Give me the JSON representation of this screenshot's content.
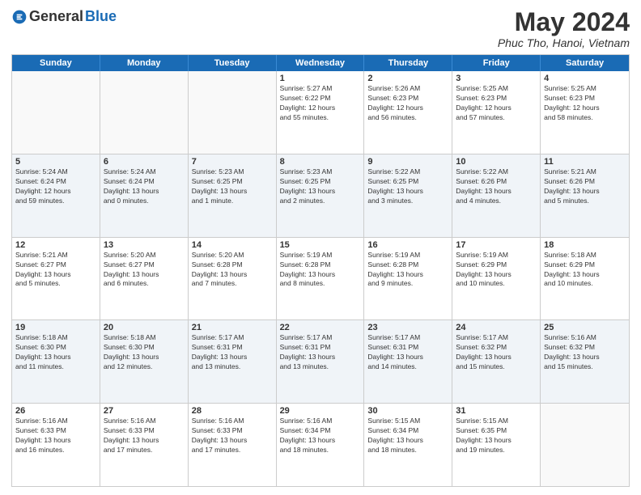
{
  "header": {
    "logo_general": "General",
    "logo_blue": "Blue",
    "title": "May 2024",
    "location": "Phuc Tho, Hanoi, Vietnam"
  },
  "days_of_week": [
    "Sunday",
    "Monday",
    "Tuesday",
    "Wednesday",
    "Thursday",
    "Friday",
    "Saturday"
  ],
  "weeks": [
    [
      {
        "day": "",
        "info": ""
      },
      {
        "day": "",
        "info": ""
      },
      {
        "day": "",
        "info": ""
      },
      {
        "day": "1",
        "info": "Sunrise: 5:27 AM\nSunset: 6:22 PM\nDaylight: 12 hours\nand 55 minutes."
      },
      {
        "day": "2",
        "info": "Sunrise: 5:26 AM\nSunset: 6:23 PM\nDaylight: 12 hours\nand 56 minutes."
      },
      {
        "day": "3",
        "info": "Sunrise: 5:25 AM\nSunset: 6:23 PM\nDaylight: 12 hours\nand 57 minutes."
      },
      {
        "day": "4",
        "info": "Sunrise: 5:25 AM\nSunset: 6:23 PM\nDaylight: 12 hours\nand 58 minutes."
      }
    ],
    [
      {
        "day": "5",
        "info": "Sunrise: 5:24 AM\nSunset: 6:24 PM\nDaylight: 12 hours\nand 59 minutes."
      },
      {
        "day": "6",
        "info": "Sunrise: 5:24 AM\nSunset: 6:24 PM\nDaylight: 13 hours\nand 0 minutes."
      },
      {
        "day": "7",
        "info": "Sunrise: 5:23 AM\nSunset: 6:25 PM\nDaylight: 13 hours\nand 1 minute."
      },
      {
        "day": "8",
        "info": "Sunrise: 5:23 AM\nSunset: 6:25 PM\nDaylight: 13 hours\nand 2 minutes."
      },
      {
        "day": "9",
        "info": "Sunrise: 5:22 AM\nSunset: 6:25 PM\nDaylight: 13 hours\nand 3 minutes."
      },
      {
        "day": "10",
        "info": "Sunrise: 5:22 AM\nSunset: 6:26 PM\nDaylight: 13 hours\nand 4 minutes."
      },
      {
        "day": "11",
        "info": "Sunrise: 5:21 AM\nSunset: 6:26 PM\nDaylight: 13 hours\nand 5 minutes."
      }
    ],
    [
      {
        "day": "12",
        "info": "Sunrise: 5:21 AM\nSunset: 6:27 PM\nDaylight: 13 hours\nand 5 minutes."
      },
      {
        "day": "13",
        "info": "Sunrise: 5:20 AM\nSunset: 6:27 PM\nDaylight: 13 hours\nand 6 minutes."
      },
      {
        "day": "14",
        "info": "Sunrise: 5:20 AM\nSunset: 6:28 PM\nDaylight: 13 hours\nand 7 minutes."
      },
      {
        "day": "15",
        "info": "Sunrise: 5:19 AM\nSunset: 6:28 PM\nDaylight: 13 hours\nand 8 minutes."
      },
      {
        "day": "16",
        "info": "Sunrise: 5:19 AM\nSunset: 6:28 PM\nDaylight: 13 hours\nand 9 minutes."
      },
      {
        "day": "17",
        "info": "Sunrise: 5:19 AM\nSunset: 6:29 PM\nDaylight: 13 hours\nand 10 minutes."
      },
      {
        "day": "18",
        "info": "Sunrise: 5:18 AM\nSunset: 6:29 PM\nDaylight: 13 hours\nand 10 minutes."
      }
    ],
    [
      {
        "day": "19",
        "info": "Sunrise: 5:18 AM\nSunset: 6:30 PM\nDaylight: 13 hours\nand 11 minutes."
      },
      {
        "day": "20",
        "info": "Sunrise: 5:18 AM\nSunset: 6:30 PM\nDaylight: 13 hours\nand 12 minutes."
      },
      {
        "day": "21",
        "info": "Sunrise: 5:17 AM\nSunset: 6:31 PM\nDaylight: 13 hours\nand 13 minutes."
      },
      {
        "day": "22",
        "info": "Sunrise: 5:17 AM\nSunset: 6:31 PM\nDaylight: 13 hours\nand 13 minutes."
      },
      {
        "day": "23",
        "info": "Sunrise: 5:17 AM\nSunset: 6:31 PM\nDaylight: 13 hours\nand 14 minutes."
      },
      {
        "day": "24",
        "info": "Sunrise: 5:17 AM\nSunset: 6:32 PM\nDaylight: 13 hours\nand 15 minutes."
      },
      {
        "day": "25",
        "info": "Sunrise: 5:16 AM\nSunset: 6:32 PM\nDaylight: 13 hours\nand 15 minutes."
      }
    ],
    [
      {
        "day": "26",
        "info": "Sunrise: 5:16 AM\nSunset: 6:33 PM\nDaylight: 13 hours\nand 16 minutes."
      },
      {
        "day": "27",
        "info": "Sunrise: 5:16 AM\nSunset: 6:33 PM\nDaylight: 13 hours\nand 17 minutes."
      },
      {
        "day": "28",
        "info": "Sunrise: 5:16 AM\nSunset: 6:33 PM\nDaylight: 13 hours\nand 17 minutes."
      },
      {
        "day": "29",
        "info": "Sunrise: 5:16 AM\nSunset: 6:34 PM\nDaylight: 13 hours\nand 18 minutes."
      },
      {
        "day": "30",
        "info": "Sunrise: 5:15 AM\nSunset: 6:34 PM\nDaylight: 13 hours\nand 18 minutes."
      },
      {
        "day": "31",
        "info": "Sunrise: 5:15 AM\nSunset: 6:35 PM\nDaylight: 13 hours\nand 19 minutes."
      },
      {
        "day": "",
        "info": ""
      }
    ]
  ],
  "alt_rows": [
    1,
    3
  ]
}
